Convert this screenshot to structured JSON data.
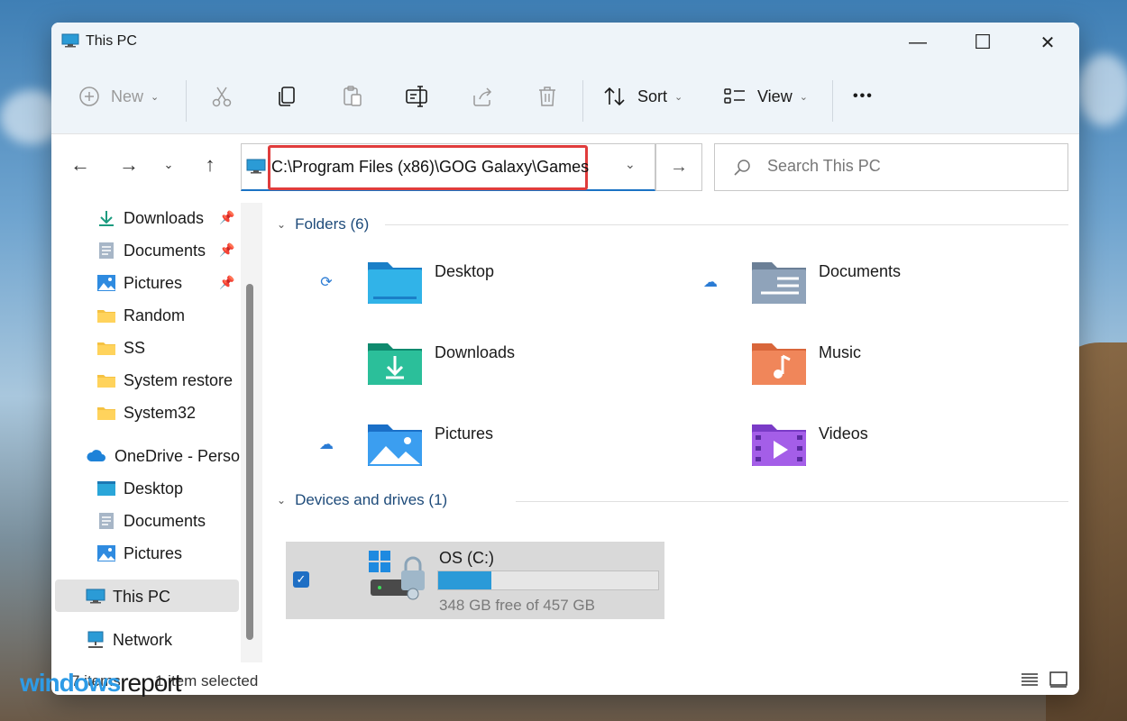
{
  "window": {
    "title": "This PC",
    "controls": {
      "minimize": "—",
      "maximize": "☐",
      "close": "✕"
    }
  },
  "toolbar": {
    "new_label": "New",
    "sort_label": "Sort",
    "view_label": "View",
    "more_label": "•••"
  },
  "address": {
    "path": "C:\\Program Files (x86)\\GOG Galaxy\\Games"
  },
  "search": {
    "placeholder": "Search This PC"
  },
  "sidebar": {
    "items": [
      {
        "label": "Downloads",
        "icon": "download-arrow-icon",
        "pinned": true
      },
      {
        "label": "Documents",
        "icon": "document-icon",
        "pinned": true
      },
      {
        "label": "Pictures",
        "icon": "picture-icon",
        "pinned": true
      },
      {
        "label": "Random",
        "icon": "folder-icon"
      },
      {
        "label": "SS",
        "icon": "folder-icon"
      },
      {
        "label": "System restore",
        "icon": "folder-icon"
      },
      {
        "label": "System32",
        "icon": "folder-icon"
      },
      {
        "label": "OneDrive - Persor",
        "icon": "cloud-icon"
      },
      {
        "label": "Desktop",
        "icon": "desktop-icon"
      },
      {
        "label": "Documents",
        "icon": "document-icon"
      },
      {
        "label": "Pictures",
        "icon": "picture-icon"
      },
      {
        "label": "This PC",
        "icon": "monitor-icon",
        "selected": true
      },
      {
        "label": "Network",
        "icon": "network-icon"
      }
    ]
  },
  "content": {
    "folders_header": "Folders (6)",
    "folders": [
      {
        "label": "Desktop",
        "status": "sync"
      },
      {
        "label": "Documents",
        "status": "cloud"
      },
      {
        "label": "Downloads",
        "status": ""
      },
      {
        "label": "Music",
        "status": ""
      },
      {
        "label": "Pictures",
        "status": "cloud"
      },
      {
        "label": "Videos",
        "status": ""
      }
    ],
    "drives_header": "Devices and drives (1)",
    "drive": {
      "label": "OS (C:)",
      "free_text": "348 GB free of 457 GB",
      "used_fraction": 0.24
    }
  },
  "statusbar": {
    "count": "7 items",
    "selected": "1 item selected"
  },
  "watermark": {
    "part1": "windows",
    "part2": "report"
  },
  "colors": {
    "accent": "#1a73c4",
    "highlight_box": "#e03c3c",
    "drive_bar": "#2a9ad8"
  }
}
